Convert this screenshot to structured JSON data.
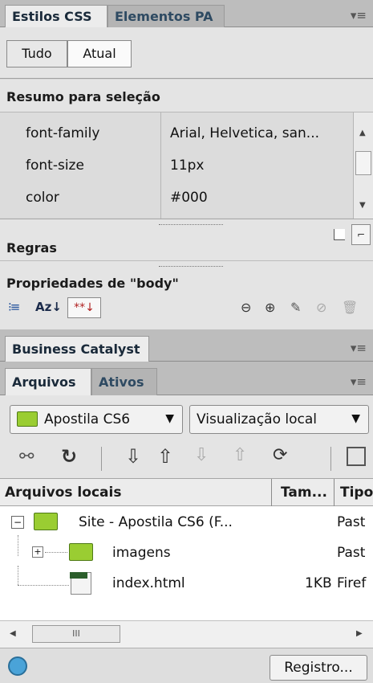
{
  "css_panel": {
    "tabs": [
      "Estilos CSS",
      "Elementos PA"
    ],
    "mode_buttons": [
      "Tudo",
      "Atual"
    ],
    "summary_title": "Resumo para seleção",
    "properties": [
      {
        "name": "font-family",
        "value": "Arial, Helvetica, san..."
      },
      {
        "name": "font-size",
        "value": "11px"
      },
      {
        "name": "color",
        "value": "#000"
      }
    ],
    "rules_title": "Regras",
    "props_title": "Propriedades de \"body\"",
    "az_label": "Az↓",
    "asterisk_label": "**↓"
  },
  "bc_panel": {
    "tab": "Business Catalyst"
  },
  "files_panel": {
    "tabs": [
      "Arquivos",
      "Ativos"
    ],
    "site_select": "Apostila CS6",
    "view_select": "Visualização local",
    "columns": [
      "Arquivos locais",
      "Tam...",
      "Tipo"
    ],
    "rows": [
      {
        "name": "Site - Apostila CS6 (F...",
        "size": "",
        "type": "Past"
      },
      {
        "name": "imagens",
        "size": "",
        "type": "Past"
      },
      {
        "name": "index.html",
        "size": "1KB",
        "type": "Firef"
      }
    ],
    "scroll_thumb": "III",
    "log_button": "Registro..."
  }
}
